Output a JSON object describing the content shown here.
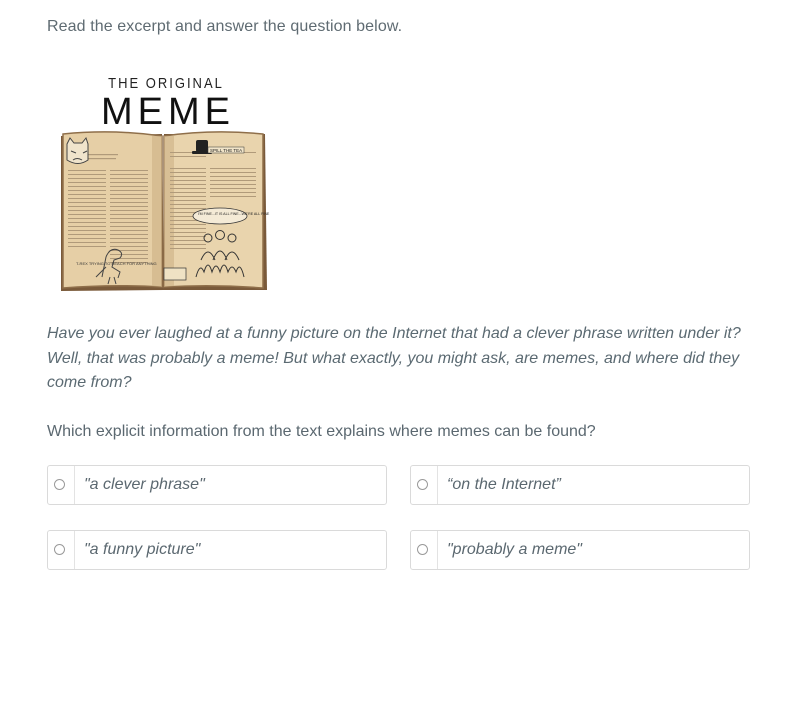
{
  "instruction": "Read the excerpt and answer the question below.",
  "figure": {
    "title_small": "THE ORIGINAL",
    "title_big": "MEME",
    "page_caption_left": "T-REX TRYING TO REACH FOR ANYTHING",
    "page_caption_top": "SPILL THE TEA",
    "speech_bubble": "I'M FINE...IT IS ALL FINE...WE'RE ALL FINE"
  },
  "passage": "Have you ever laughed at a funny picture on the Internet that had a clever phrase written under it? Well, that was probably a meme! But what exactly, you might ask, are memes, and where did they come from?",
  "question": "Which explicit information from the text explains where memes can be found?",
  "choices": [
    {
      "label": "\"a clever phrase\""
    },
    {
      "label": "“on the Internet”"
    },
    {
      "label": "\"a funny picture\""
    },
    {
      "label": "\"probably a meme\""
    }
  ],
  "colors": {
    "text": "#5d6b73",
    "border": "#dadada",
    "paper": "#e8d3ad",
    "paper_edge": "#8a6a45"
  }
}
